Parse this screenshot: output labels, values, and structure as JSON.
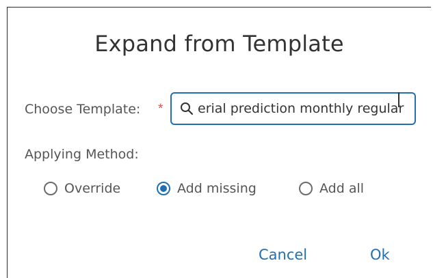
{
  "dialog": {
    "title": "Expand from Template",
    "choose_template": {
      "label": "Choose Template:",
      "required_marker": "*",
      "search_value": "erial prediction monthly regular"
    },
    "applying_method": {
      "label": "Applying Method:",
      "options": [
        {
          "label": "Override",
          "selected": false
        },
        {
          "label": "Add missing",
          "selected": true
        },
        {
          "label": "Add all",
          "selected": false
        }
      ]
    },
    "buttons": {
      "cancel": "Cancel",
      "ok": "Ok"
    }
  },
  "colors": {
    "accent": "#1f6fb2",
    "required": "#d9534f",
    "text": "#555555",
    "title": "#333333"
  },
  "icons": {
    "search": "search-icon"
  }
}
